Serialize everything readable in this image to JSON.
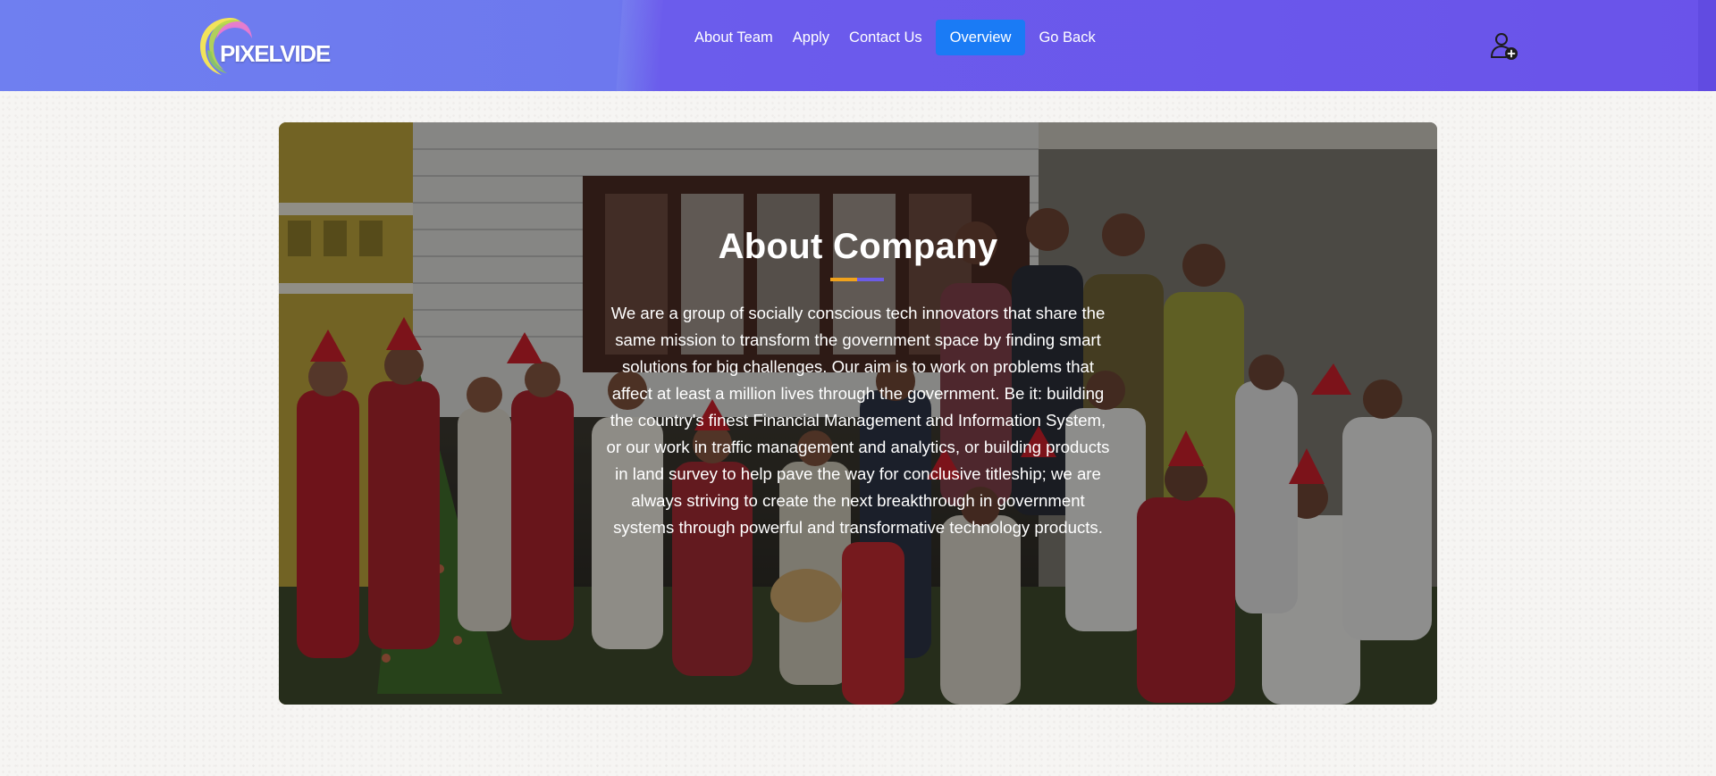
{
  "brand": {
    "logo_text": "PIXELVIDE"
  },
  "nav": {
    "items": [
      {
        "label": "About Team"
      },
      {
        "label": "Apply"
      },
      {
        "label": "Contact Us"
      },
      {
        "label": "Overview",
        "active": true
      },
      {
        "label": "Go Back"
      }
    ]
  },
  "header": {
    "user_icon": "user-add-icon"
  },
  "hero": {
    "title": "About Company",
    "body": "We are a group of socially conscious tech innovators that share the same mission to transform the government space by finding smart solutions for big challenges. Our aim is to work on problems that affect at least a million lives through the government. Be it: building the country's finest Financial Management and Information System, or our work in traffic management and analytics, or building products in land survey to help pave the way for conclusive titleship; we are always striving to create the next breakthrough in government systems through powerful and transformative technology products."
  },
  "colors": {
    "header_start": "#6f7ff0",
    "header_end": "#6a53ea",
    "active_nav": "#1a7bf5",
    "underline_orange": "#f0a21c",
    "underline_purple": "#6c5ce7"
  }
}
